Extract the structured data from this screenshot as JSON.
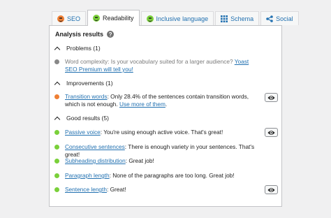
{
  "tabs": [
    {
      "label": "SEO",
      "icon": "smiley-face-icon",
      "color": "#ef7f34"
    },
    {
      "label": "Readability",
      "icon": "smiley-face-icon",
      "color": "#7ad03a"
    },
    {
      "label": "Inclusive language",
      "icon": "smiley-face-icon",
      "color": "#7ad03a"
    },
    {
      "label": "Schema",
      "icon": "grid-icon",
      "color": "#2271b1"
    },
    {
      "label": "Social",
      "icon": "share-icon",
      "color": "#2271b1"
    }
  ],
  "panel": {
    "title": "Analysis results",
    "help_glyph": "?"
  },
  "sections": {
    "problems": {
      "heading": "Problems (1)",
      "items": [
        {
          "text": "Word complexity: Is your vocabulary suited for a larger audience? ",
          "link": "Yoast SEO Premium will tell you!",
          "color": "#888888"
        }
      ]
    },
    "improvements": {
      "heading": "Improvements (1)",
      "items": [
        {
          "link": "Transition words",
          "text": ": Only 28.4% of the sentences contain transition words, which is not enough. ",
          "link2": "Use more of them",
          "tail": ".",
          "color": "#ef7f34"
        }
      ]
    },
    "good": {
      "heading": "Good results (5)",
      "items": [
        {
          "link": "Passive voice",
          "text": ": You're using enough active voice. That's great!",
          "color": "#7ad03a"
        },
        {
          "link": "Consecutive sentences",
          "text": ": There is enough variety in your sentences. That's great!",
          "color": "#7ad03a"
        },
        {
          "link": "Subheading distribution",
          "text": ": Great job!",
          "color": "#7ad03a"
        },
        {
          "link": "Paragraph length",
          "text": ": None of the paragraphs are too long. Great job!",
          "color": "#7ad03a"
        },
        {
          "link": "Sentence length",
          "text": ": Great!",
          "color": "#7ad03a"
        }
      ]
    }
  }
}
